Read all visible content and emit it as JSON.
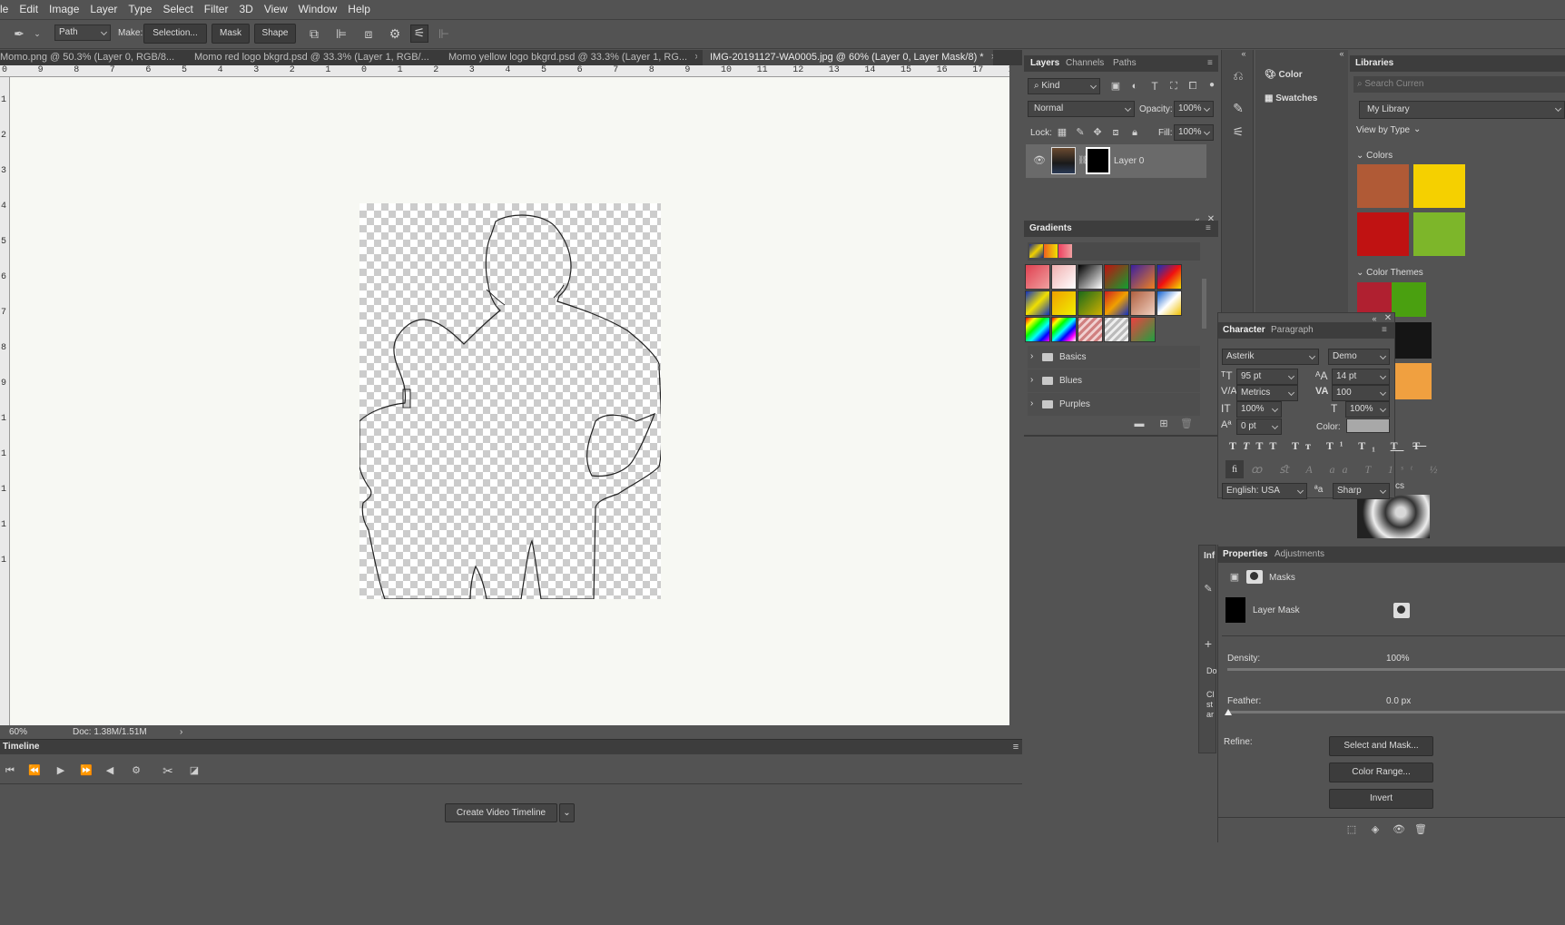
{
  "menu": [
    "le",
    "Edit",
    "Image",
    "Layer",
    "Type",
    "Select",
    "Filter",
    "3D",
    "View",
    "Window",
    "Help"
  ],
  "options": {
    "tool_mode": "Path",
    "make_label": "Make:",
    "selection_btn": "Selection...",
    "mask_btn": "Mask",
    "shape_btn": "Shape"
  },
  "doc_tabs": [
    {
      "label": "Momo.png @ 50.3% (Layer 0, RGB/8...",
      "close": "×"
    },
    {
      "label": "Momo red logo bkgrd.psd @ 33.3% (Layer 1, RGB/...",
      "close": "×"
    },
    {
      "label": "Momo yellow logo bkgrd.psd @ 33.3% (Layer 1, RG...",
      "close": "×"
    },
    {
      "label": "IMG-20191127-WA0005.jpg @ 60% (Layer 0, Layer Mask/8) *",
      "close": "×"
    }
  ],
  "ruler_h": [
    "0",
    "9",
    "8",
    "7",
    "6",
    "5",
    "4",
    "3",
    "2",
    "1",
    "0",
    "1",
    "2",
    "3",
    "4",
    "5",
    "6",
    "7",
    "8",
    "9",
    "10",
    "11",
    "12",
    "13",
    "14",
    "15",
    "16",
    "17",
    "1"
  ],
  "ruler_v": [
    "1",
    "2",
    "3",
    "4",
    "5",
    "6",
    "7",
    "8",
    "9",
    "1",
    "1",
    "1",
    "1",
    "1"
  ],
  "status": {
    "zoom": "60%",
    "doc": "Doc: 1.38M/1.51M",
    "arrow": "›"
  },
  "timeline": {
    "title": "Timeline",
    "create_btn": "Create Video Timeline"
  },
  "layers": {
    "tabs": [
      "Layers",
      "Channels",
      "Paths"
    ],
    "filter_kind": "Kind",
    "blend": "Normal",
    "opacity_label": "Opacity:",
    "opacity": "100%",
    "lock_label": "Lock:",
    "fill_label": "Fill:",
    "fill": "100%",
    "layer_name": "Layer 0"
  },
  "gradients": {
    "title": "Gradients",
    "folders": [
      "Basics",
      "Blues",
      "Purples"
    ]
  },
  "side_panel": {
    "color": "Color",
    "swatches": "Swatches"
  },
  "libraries": {
    "title": "Libraries",
    "search_placeholder": "Search Curren",
    "library": "My Library",
    "view_by": "View by Type",
    "colors": "Colors",
    "color_themes": "Color Themes",
    "swatch_colors": [
      "#b05a36",
      "#f5d000",
      "#c01212",
      "#7db62a",
      "#b02030",
      "#4aa010",
      "#151515",
      "#f0a040"
    ]
  },
  "character": {
    "tabs": [
      "Character",
      "Paragraph"
    ],
    "font": "Asterik",
    "style": "Demo",
    "size": "95 pt",
    "leading": "14 pt",
    "kerning": "Metrics",
    "tracking": "100",
    "vscale": "100%",
    "hscale": "100%",
    "baseline": "0 pt",
    "color_label": "Color:",
    "language": "English: USA",
    "aa_label": "ªa",
    "antialias": "Sharp"
  },
  "properties": {
    "tabs": [
      "Properties",
      "Adjustments"
    ],
    "side_label": "Inf",
    "masks": "Masks",
    "layer_mask": "Layer Mask",
    "density_label": "Density:",
    "density": "100%",
    "feather_label": "Feather:",
    "feather": "0.0 px",
    "refine_label": "Refine:",
    "select_mask_btn": "Select and Mask...",
    "color_range_btn": "Color Range...",
    "invert_btn": "Invert",
    "side_texts": [
      "Do",
      "Cl",
      "st",
      "ar"
    ]
  },
  "clipped_text": "cs"
}
